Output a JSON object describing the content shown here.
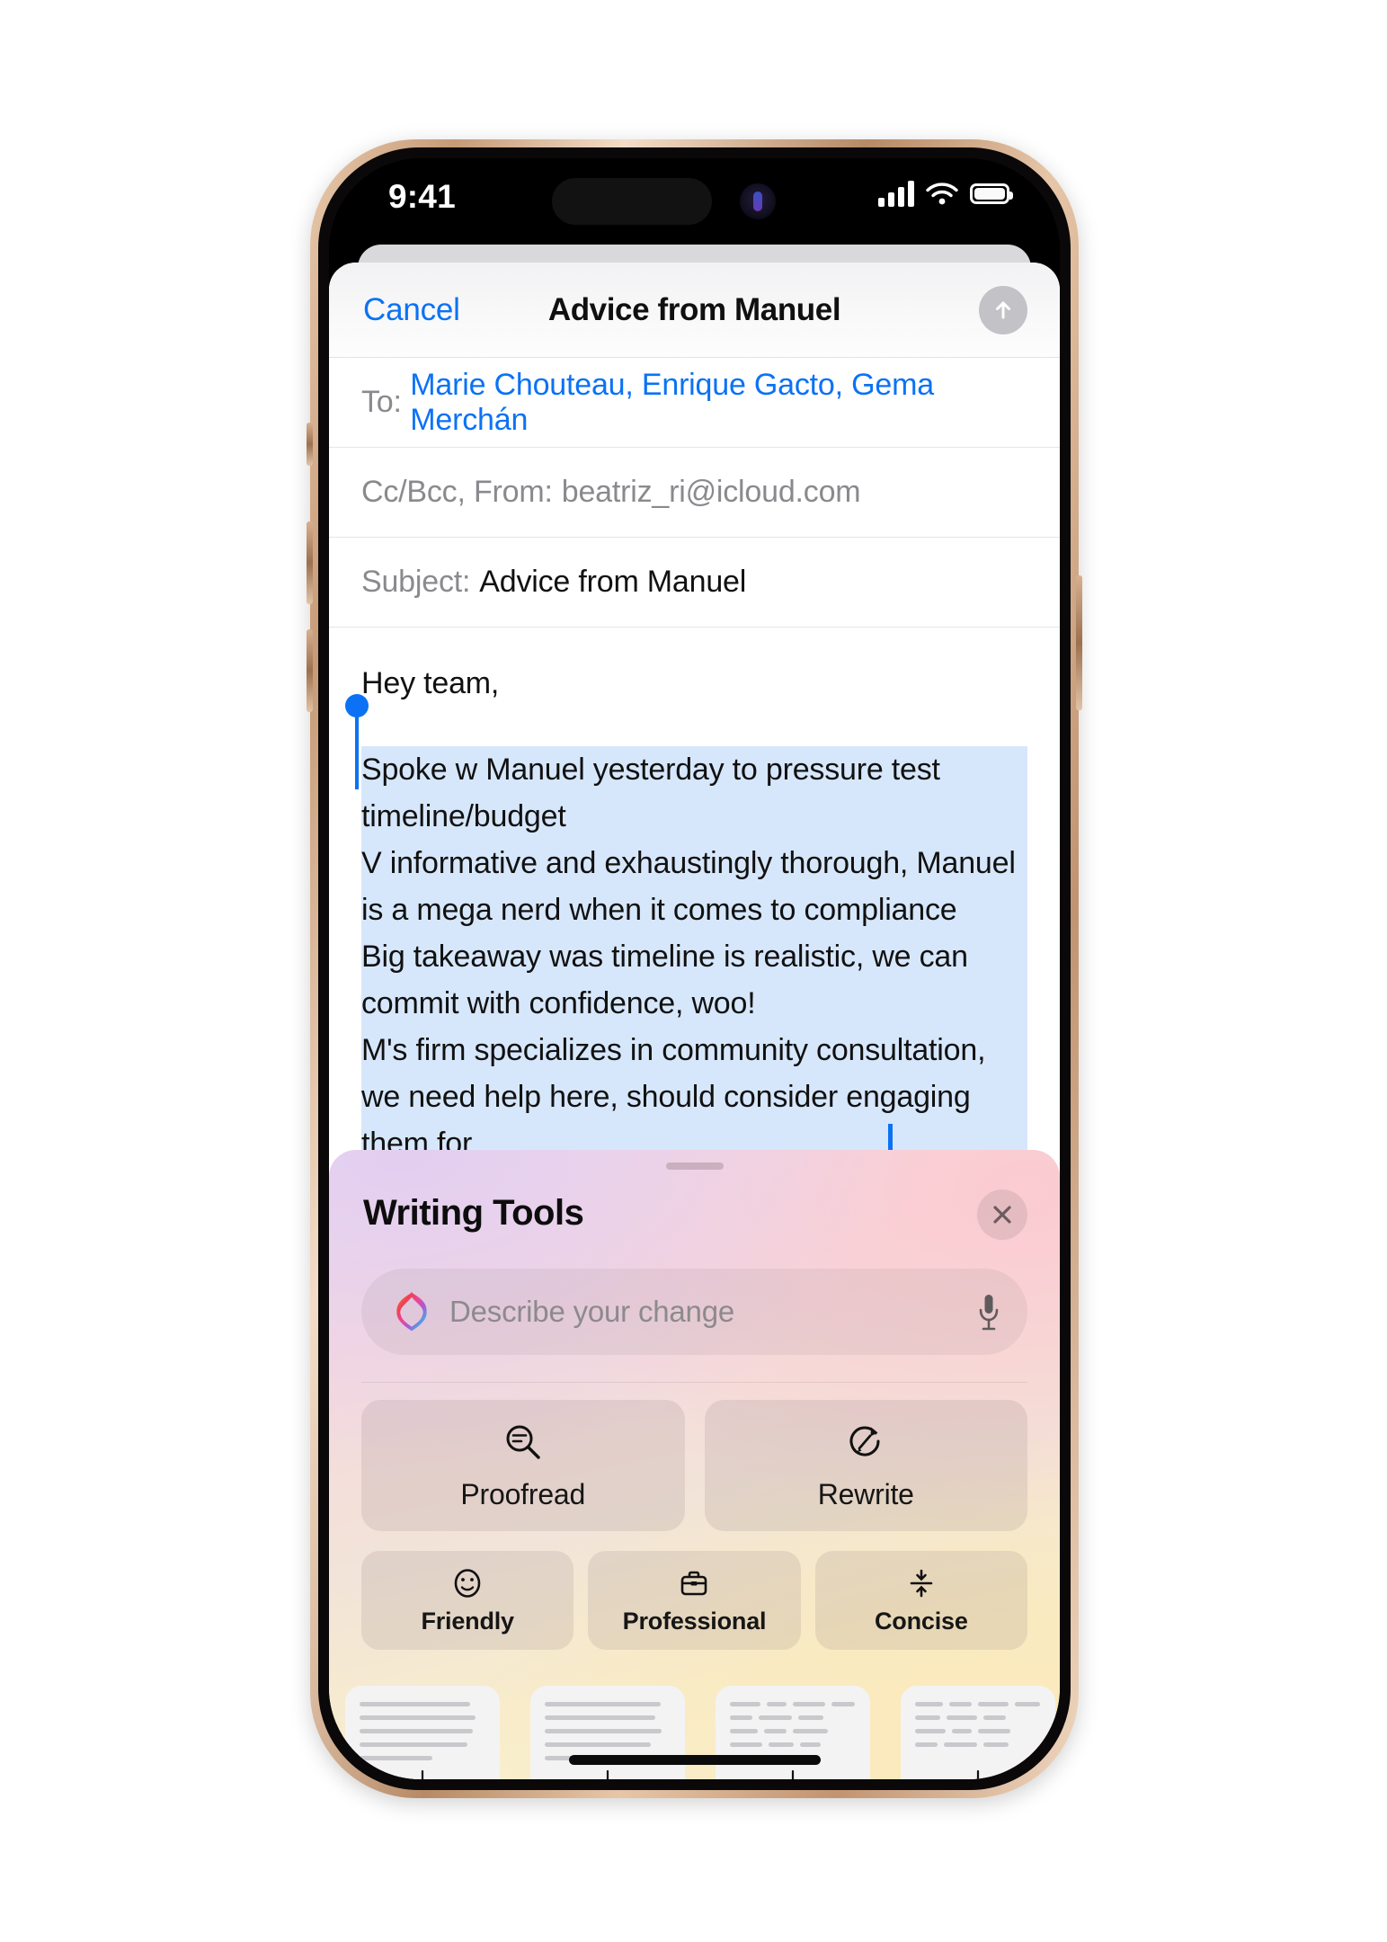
{
  "status_bar": {
    "time": "9:41",
    "cellular_icon": "signal-bars-icon",
    "wifi_icon": "wifi-icon",
    "battery_icon": "battery-icon"
  },
  "mail_compose": {
    "cancel_label": "Cancel",
    "title": "Advice from Manuel",
    "send_icon": "send-arrow-up-icon",
    "to": {
      "label": "To:",
      "value": "Marie Chouteau, Enrique Gacto, Gema Merchán"
    },
    "ccbcc": {
      "label": "Cc/Bcc, From:",
      "value": "beatriz_ri@icloud.com"
    },
    "subject": {
      "label": "Subject:",
      "value": "Advice from Manuel"
    },
    "body": {
      "greeting": "Hey team,",
      "selected_lines": [
        "Spoke w Manuel yesterday to pressure test timeline/budget",
        "V informative and exhaustingly thorough, Manuel is a mega nerd when it comes to compliance",
        "Big takeaway was timeline is realistic, we can commit with confidence, woo!",
        "M's firm specializes in community consultation, we need help here, should consider engaging",
        "them for... "
      ]
    }
  },
  "writing_tools": {
    "title": "Writing Tools",
    "close_icon": "close-icon",
    "prompt": {
      "placeholder": "Describe your change",
      "leading_icon": "apple-intelligence-icon",
      "mic_icon": "microphone-icon"
    },
    "primary_actions": [
      {
        "label": "Proofread",
        "icon": "proofread-magnifier-icon"
      },
      {
        "label": "Rewrite",
        "icon": "rewrite-circular-pencil-icon"
      }
    ],
    "tone_actions": [
      {
        "label": "Friendly",
        "icon": "smiley-face-icon"
      },
      {
        "label": "Professional",
        "icon": "briefcase-icon"
      },
      {
        "label": "Concise",
        "icon": "compress-arrows-icon"
      }
    ],
    "format_cards": [
      {
        "icon": "summary-document-icon",
        "arrow": "download-arrow-icon"
      },
      {
        "icon": "key-points-document-icon",
        "arrow": "download-arrow-icon"
      },
      {
        "icon": "list-document-icon",
        "arrow": "download-arrow-icon"
      },
      {
        "icon": "table-document-icon",
        "arrow": "download-arrow-icon"
      }
    ]
  },
  "colors": {
    "accent_blue": "#0b72f5",
    "selection_blue": "#d7e7fb",
    "panel_top": "#efdcef",
    "panel_bottom": "#fbf3d8"
  }
}
